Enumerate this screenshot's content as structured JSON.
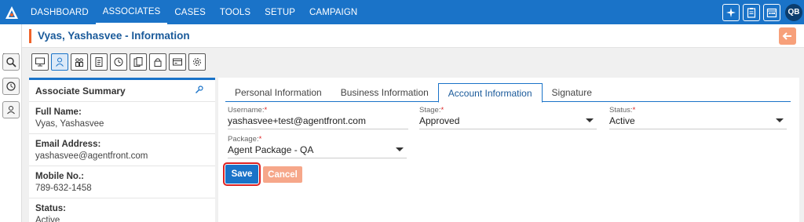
{
  "nav": {
    "items": [
      {
        "label": "DASHBOARD",
        "active": false
      },
      {
        "label": "ASSOCIATES",
        "active": true
      },
      {
        "label": "CASES",
        "active": false
      },
      {
        "label": "TOOLS",
        "active": false
      },
      {
        "label": "SETUP",
        "active": false
      },
      {
        "label": "CAMPAIGN",
        "active": false
      }
    ],
    "right_icons": [
      "sparkle-icon",
      "clipboard-icon",
      "calendar-icon"
    ],
    "avatar": "QB"
  },
  "header": {
    "title": "Vyas, Yashasvee - Information"
  },
  "toolbar": {
    "icons": [
      "monitor-icon",
      "person-icon",
      "people-icon",
      "document-icon",
      "clock-icon",
      "files-icon",
      "lock-icon",
      "card-icon",
      "gear-icon"
    ],
    "active_index": 1
  },
  "summary": {
    "title": "Associate Summary",
    "fields": [
      {
        "label": "Full Name:",
        "value": "Vyas, Yashasvee"
      },
      {
        "label": "Email Address:",
        "value": "yashasvee@agentfront.com"
      },
      {
        "label": "Mobile No.:",
        "value": "789-632-1458"
      },
      {
        "label": "Status:",
        "value": "Active"
      }
    ]
  },
  "tabs": [
    {
      "label": "Personal Information",
      "active": false
    },
    {
      "label": "Business Information",
      "active": false
    },
    {
      "label": "Account Information",
      "active": true
    },
    {
      "label": "Signature",
      "active": false
    }
  ],
  "form": {
    "username": {
      "label": "Username:",
      "value": "yashasvee+test@agentfront.com"
    },
    "stage": {
      "label": "Stage:",
      "value": "Approved"
    },
    "status": {
      "label": "Status:",
      "value": "Active"
    },
    "package": {
      "label": "Package:",
      "value": "Agent Package - QA"
    },
    "required_mark": "*",
    "save_label": "Save",
    "cancel_label": "Cancel"
  },
  "colors": {
    "primary": "#1a73c8",
    "accent": "#f0632a",
    "cancel": "#f6a78a",
    "highlight": "#d22222"
  }
}
